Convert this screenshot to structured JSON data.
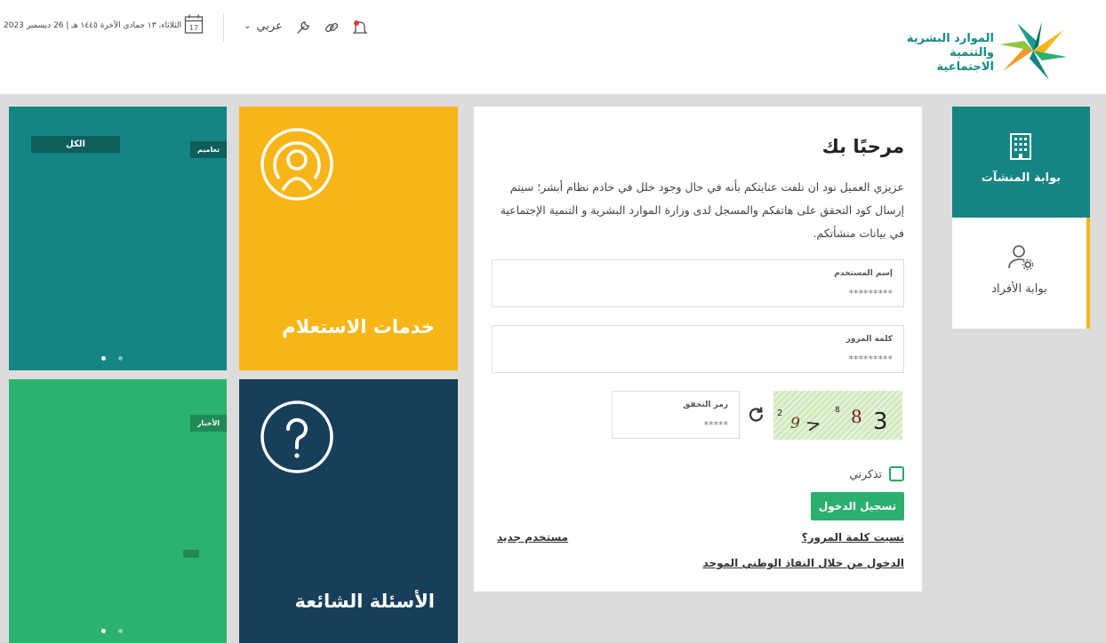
{
  "header": {
    "logo_lines": [
      "الموارد البشرية",
      "والتنمية الاجتماعية"
    ],
    "date": "الثلاثاء، ١٣ جمادى الآخرة ١٤٤٥ هـ | 26 ديسمبر 2023",
    "calendar_day": "17",
    "language": "عربي"
  },
  "tiles": {
    "news_all": "الكل",
    "circulars": "تعاميم",
    "news": "الأخبار",
    "inquiry_title": "خدمات الاستعلام",
    "faq_title": "الأسئلة الشائعة"
  },
  "login": {
    "welcome": "مرحبًا بك",
    "intro": "عزيزي العميل نود ان نلفت عنايتكم بأنه في حال وجود خلل في خادم نظام أبشر؛ سيتم إرسال كود التحقق على هاتفكم والمسجل لدى وزارة الموارد البشرية و التنمية الإجتماعية في بيانات منشأتكم.",
    "username_label": "إسم المستخدم",
    "username_placeholder": "*********",
    "password_label": "كلمة المرور",
    "password_placeholder": "*********",
    "code_label": "رمز التحقق",
    "code_placeholder": "*****",
    "captcha_chars": [
      "3",
      "8",
      "8",
      ">",
      "2",
      "9",
      "2"
    ],
    "remember_me": "تذكرني",
    "login_button": "تسجيل الدخول",
    "forgot_password": "نسيت كلمة المرور؟",
    "new_user": "مستخدم جديد",
    "nafath_login": "الدخول من خلال النفاذ الوطني الموحد"
  },
  "portals": {
    "establishments": "بوابة المنشآت",
    "individuals": "بوابة الأفراد"
  },
  "colors": {
    "teal": "#148583",
    "yellow": "#f8b517",
    "green": "#2cb26f",
    "navy": "#173f5a"
  }
}
